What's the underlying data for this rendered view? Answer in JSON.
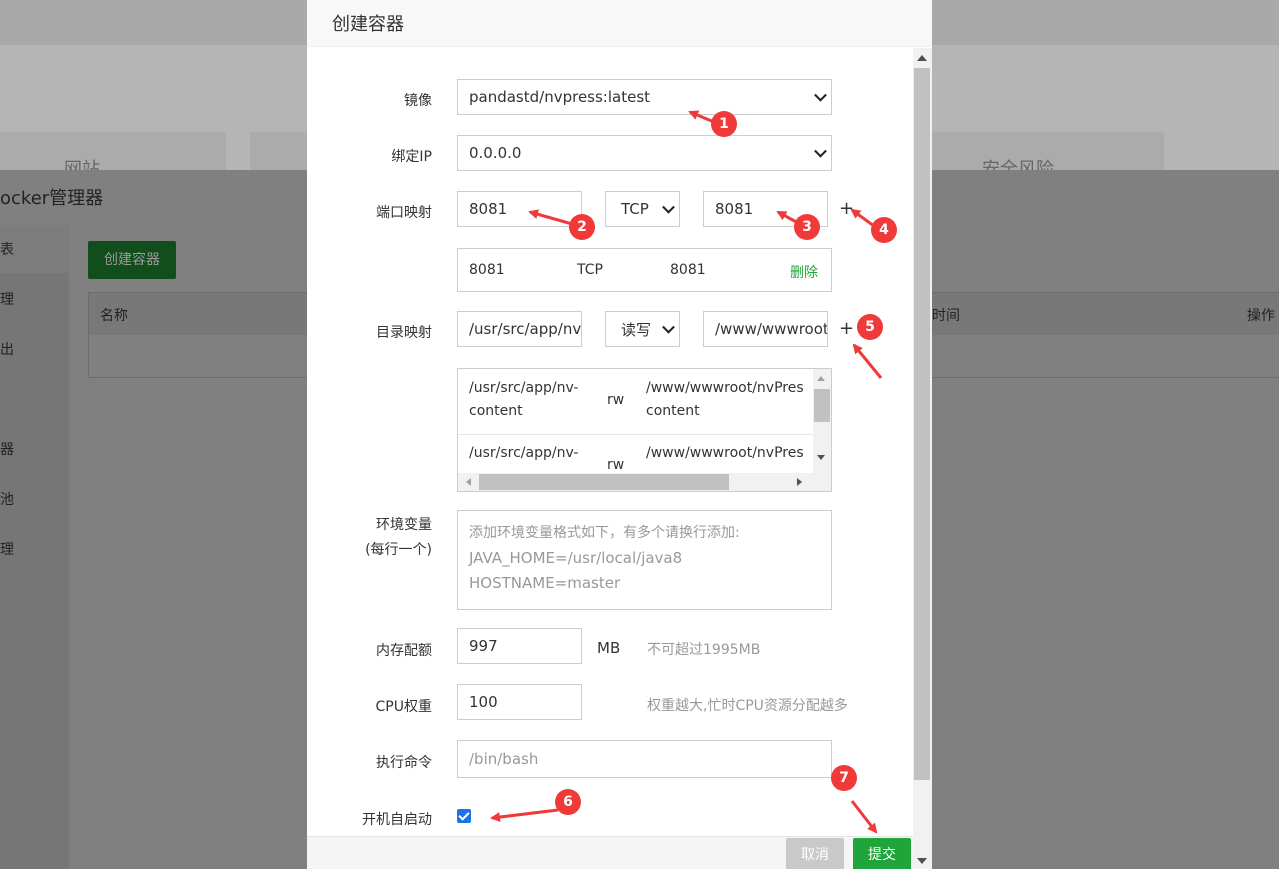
{
  "background": {
    "panel_title": "ocker管理器",
    "cards": [
      "网站",
      "安全风险"
    ],
    "sidebar_items": [
      "表",
      "理",
      "出",
      "器",
      "池",
      "理"
    ],
    "create_button": "创建容器",
    "table_headers": [
      "名称",
      "时间",
      "操作"
    ]
  },
  "modal": {
    "title": "创建容器",
    "image": {
      "label": "镜像",
      "value": "pandastd/nvpress:latest"
    },
    "bind_ip": {
      "label": "绑定IP",
      "value": "0.0.0.0"
    },
    "port_mapping": {
      "label": "端口映射",
      "container_port": "8081",
      "protocol": "TCP",
      "host_port": "8081",
      "add_symbol": "+",
      "rows": [
        {
          "container_port": "8081",
          "protocol": "TCP",
          "host_port": "8081",
          "delete_label": "删除"
        }
      ]
    },
    "dir_mapping": {
      "label": "目录映射",
      "container_dir": "/usr/src/app/nv",
      "permission": "读写",
      "host_dir": "/www/wwwroot",
      "add_symbol": "+",
      "rows": [
        {
          "container_line1": "/usr/src/app/nv-",
          "container_line2": "content",
          "mode": "rw",
          "host_line1": "/www/wwwroot/nvPres",
          "host_line2": "content"
        },
        {
          "container_line1": "/usr/src/app/nv-",
          "container_line2": "",
          "mode": "rw",
          "host_line1": "/www/wwwroot/nvPres",
          "host_line2": ""
        }
      ]
    },
    "env": {
      "label_line1": "环境变量",
      "label_line2": "(每行一个)",
      "placeholder_line1": "添加环境变量格式如下，有多个请换行添加:",
      "placeholder_line2": "JAVA_HOME=/usr/local/java8",
      "placeholder_line3": "HOSTNAME=master"
    },
    "memory": {
      "label": "内存配额",
      "value": "997",
      "unit": "MB",
      "hint": "不可超过1995MB"
    },
    "cpu": {
      "label": "CPU权重",
      "value": "100",
      "hint": "权重越大,忙时CPU资源分配越多"
    },
    "command": {
      "label": "执行命令",
      "placeholder": "/bin/bash"
    },
    "autostart": {
      "label": "开机自启动",
      "checked": true
    },
    "buttons": {
      "cancel": "取消",
      "submit": "提交"
    }
  },
  "annotations": {
    "badges": [
      "1",
      "2",
      "3",
      "4",
      "5",
      "6",
      "7"
    ],
    "color": "#f03a3a"
  },
  "colors": {
    "accent": "#20a53a",
    "checkbox": "#1a73e8"
  }
}
